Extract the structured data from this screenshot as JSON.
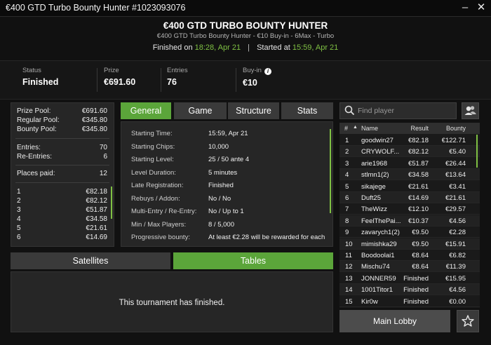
{
  "window": {
    "title": "€400 GTD Turbo Bounty Hunter #1023093076",
    "minimize_glyph": "–",
    "close_glyph": "✕"
  },
  "header": {
    "title": "€400 GTD TURBO BOUNTY HUNTER",
    "subtitle": "€400 GTD Turbo Bounty Hunter - €10 Buy-in - 6Max - Turbo",
    "finished_label": "Finished on",
    "finished_value": "18:28, Apr 21",
    "separator": "|",
    "started_label": "Started at",
    "started_value": "15:59, Apr 21"
  },
  "stats": {
    "status": {
      "label": "Status",
      "value": "Finished"
    },
    "prize": {
      "label": "Prize",
      "value": "€691.60"
    },
    "entries": {
      "label": "Entries",
      "value": "76"
    },
    "buyin": {
      "label": "Buy-in",
      "value": "€10"
    }
  },
  "prize_panel": {
    "prize_pool": {
      "label": "Prize Pool:",
      "value": "€691.60"
    },
    "regular_pool": {
      "label": "Regular Pool:",
      "value": "€345.80"
    },
    "bounty_pool": {
      "label": "Bounty Pool:",
      "value": "€345.80"
    },
    "entries": {
      "label": "Entries:",
      "value": "70"
    },
    "reentries": {
      "label": "Re-Entries:",
      "value": "6"
    },
    "places_paid": {
      "label": "Places paid:",
      "value": "12"
    },
    "payouts": [
      {
        "place": "1",
        "amount": "€82.18"
      },
      {
        "place": "2",
        "amount": "€82.12"
      },
      {
        "place": "3",
        "amount": "€51.87"
      },
      {
        "place": "4",
        "amount": "€34.58"
      },
      {
        "place": "5",
        "amount": "€21.61"
      },
      {
        "place": "6",
        "amount": "€14.69"
      }
    ]
  },
  "tabs": [
    {
      "label": "General",
      "active": true
    },
    {
      "label": "Game",
      "active": false
    },
    {
      "label": "Structure",
      "active": false
    },
    {
      "label": "Stats",
      "active": false
    }
  ],
  "info": [
    {
      "label": "Starting Time:",
      "value": "15:59, Apr 21"
    },
    {
      "label": "Starting Chips:",
      "value": "10,000"
    },
    {
      "label": "Starting Level:",
      "value": "25 / 50 ante 4"
    },
    {
      "label": "Level Duration:",
      "value": "5 minutes"
    },
    {
      "label": "Late Registration:",
      "value": "Finished"
    },
    {
      "label": "Rebuys / Addon:",
      "value": "No / No"
    },
    {
      "label": "Multi-Entry / Re-Entry:",
      "value": "No / Up to 1"
    },
    {
      "label": "Min / Max Players:",
      "value": "8 / 5,000"
    },
    {
      "label": "Progressive bounty:",
      "value": "At least €2.28 will be rewarded for each"
    }
  ],
  "bottom_tabs": [
    {
      "label": "Satellites",
      "active": false
    },
    {
      "label": "Tables",
      "active": true
    }
  ],
  "finished_message": "This tournament has finished.",
  "search": {
    "placeholder": "Find player"
  },
  "player_table": {
    "headers": {
      "rank": "#",
      "name": "Name",
      "result": "Result",
      "bounty": "Bounty"
    },
    "sort_glyph": "▲",
    "rows": [
      {
        "rank": "1",
        "name": "goodwin27",
        "result": "€82.18",
        "bounty": "€122.71"
      },
      {
        "rank": "2",
        "name": "CRYWOLF...",
        "result": "€82.12",
        "bounty": "€5.40"
      },
      {
        "rank": "3",
        "name": "arie1968",
        "result": "€51.87",
        "bounty": "€26.44"
      },
      {
        "rank": "4",
        "name": "stlmn1(2)",
        "result": "€34.58",
        "bounty": "€13.64"
      },
      {
        "rank": "5",
        "name": "sikajege",
        "result": "€21.61",
        "bounty": "€3.41"
      },
      {
        "rank": "6",
        "name": "Duft25",
        "result": "€14.69",
        "bounty": "€21.61"
      },
      {
        "rank": "7",
        "name": "TheWizz",
        "result": "€12.10",
        "bounty": "€29.57"
      },
      {
        "rank": "8",
        "name": "FeelThePai...",
        "result": "€10.37",
        "bounty": "€4.56"
      },
      {
        "rank": "9",
        "name": "zavarych1(2)",
        "result": "€9.50",
        "bounty": "€2.28"
      },
      {
        "rank": "10",
        "name": "mimishka29",
        "result": "€9.50",
        "bounty": "€15.91"
      },
      {
        "rank": "11",
        "name": "Boodoolai1",
        "result": "€8.64",
        "bounty": "€6.82"
      },
      {
        "rank": "12",
        "name": "Mischu74",
        "result": "€8.64",
        "bounty": "€11.39"
      },
      {
        "rank": "13",
        "name": "JONNER59",
        "result": "Finished",
        "bounty": "€15.95"
      },
      {
        "rank": "14",
        "name": "1001Titor1",
        "result": "Finished",
        "bounty": "€4.56"
      },
      {
        "rank": "15",
        "name": "Kir0w",
        "result": "Finished",
        "bounty": "€0.00"
      }
    ]
  },
  "main_lobby_label": "Main Lobby",
  "colors": {
    "accent": "#5ba53a",
    "highlight_text": "#7fc043",
    "background": "#111111",
    "panel": "#262626"
  },
  "icons": [
    "search-icon",
    "users-icon",
    "star-icon",
    "info-icon",
    "minimize-icon",
    "close-icon",
    "sort-up-icon"
  ]
}
